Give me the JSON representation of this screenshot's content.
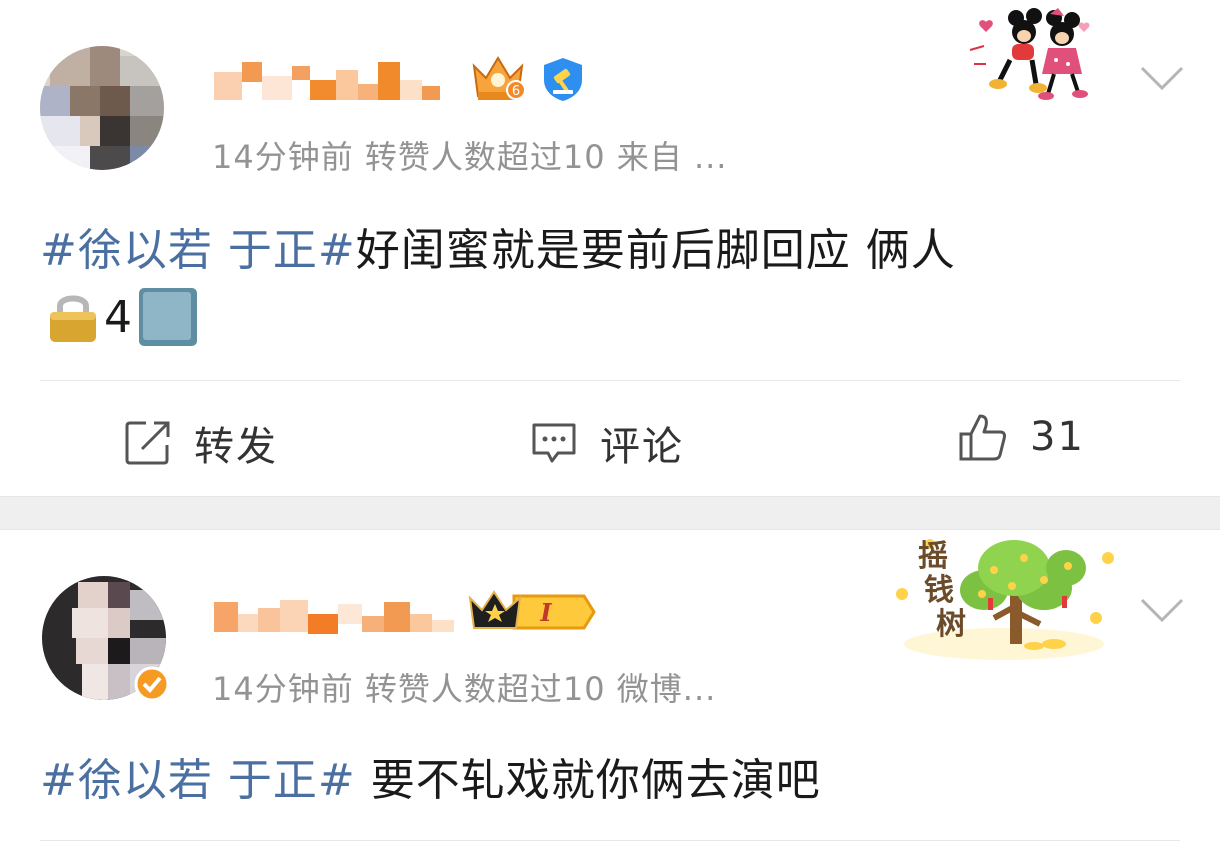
{
  "posts": [
    {
      "meta": "14分钟前  转赞人数超过10   来自 ...",
      "content_tag": "#徐以若 于正#",
      "content_text": "好闺蜜就是要前后脚回应 俩人",
      "content_line2_text": "4",
      "level_badge": "6",
      "actions": {
        "repost": "转发",
        "comment": "评论",
        "like_count": "31"
      }
    },
    {
      "meta": "14分钟前  转赞人数超过10   微博...",
      "content_tag": "#徐以若 于正#",
      "content_text": " 要不轧戏就你俩去演吧",
      "vip_badge": "I",
      "sticker_text": [
        "摇",
        "钱",
        "树"
      ]
    }
  ],
  "icons": {
    "more": "chevron-down-icon",
    "repost": "repost-icon",
    "comment": "comment-icon",
    "like": "thumbs-up-icon",
    "lock": "lock-emoji",
    "square": "blue-square-emoji"
  },
  "colors": {
    "hashtag": "#4a6fa0",
    "meta": "#939393",
    "orange": "#f08a2a",
    "separator": "#efefef"
  }
}
